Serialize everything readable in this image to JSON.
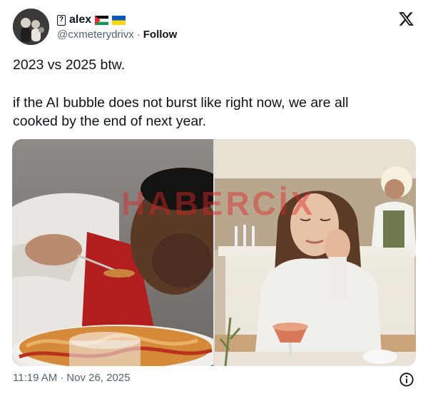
{
  "user": {
    "name": "alex",
    "handle": "@cxmeterydrivx",
    "separator": "·",
    "follow_label": "Follow"
  },
  "tweet": {
    "line1": "2023 vs 2025 btw.",
    "line2": "if the AI bubble does not burst like right now, we are all",
    "line3": "cooked by the end of next year."
  },
  "media": {
    "watermark": "HABERCİX"
  },
  "footer": {
    "time": "11:19 AM",
    "separator": "·",
    "date": "Nov 26, 2025"
  },
  "icons": {
    "logo": "x-logo-icon",
    "info": "info-icon",
    "flags": [
      "palestine-flag-icon",
      "ukraine-flag-icon"
    ]
  },
  "colors": {
    "text": "#0f1419",
    "secondary": "#536471",
    "watermark": "#dc2828"
  }
}
